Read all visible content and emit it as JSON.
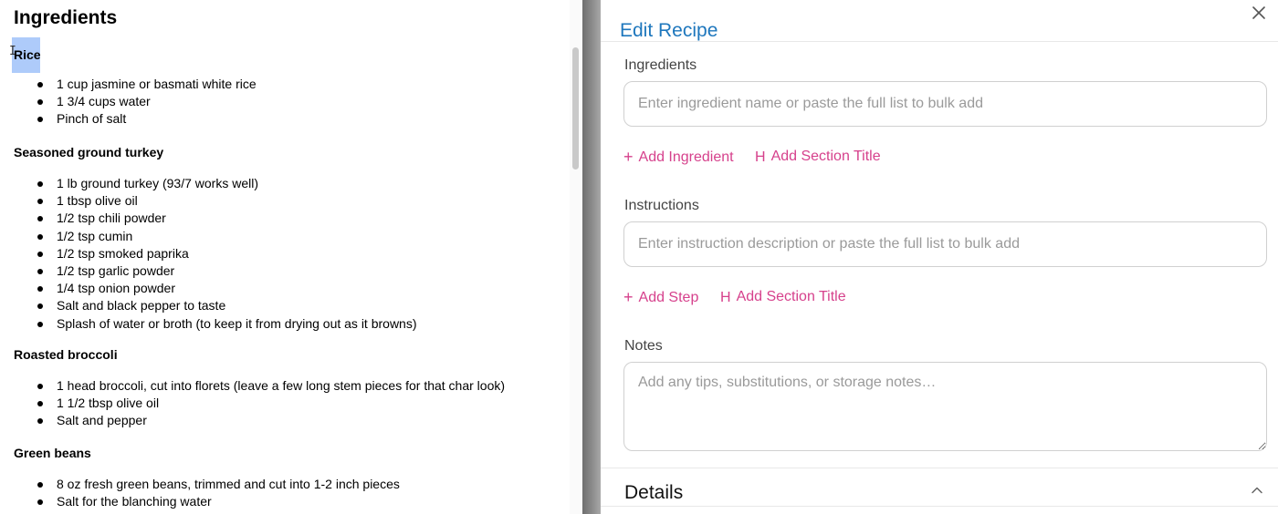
{
  "document": {
    "title": "Ingredients",
    "sections": [
      {
        "title": "Rice",
        "items": [
          "1 cup jasmine or basmati white rice",
          "1 3/4 cups water",
          "Pinch of salt"
        ]
      },
      {
        "title": "Seasoned ground turkey",
        "items": [
          "1 lb ground turkey (93/7 works well)",
          "1 tbsp olive oil",
          "1/2 tsp chili powder",
          "1/2 tsp cumin",
          "1/2 tsp smoked paprika",
          "1/2 tsp garlic powder",
          "1/4 tsp onion powder",
          "Salt and black pepper to taste",
          "Splash of water or broth (to keep it from drying out as it browns)"
        ]
      },
      {
        "title": "Roasted broccoli",
        "items": [
          "1 head broccoli, cut into florets (leave a few long stem pieces for that char look)",
          "1 1/2 tbsp olive oil",
          "Salt and pepper"
        ]
      },
      {
        "title": "Green beans",
        "items": [
          "8 oz fresh green beans, trimmed and cut into 1-2 inch pieces",
          "Salt for the blanching water"
        ]
      }
    ]
  },
  "modal": {
    "title": "Edit Recipe",
    "ingredients": {
      "label": "Ingredients",
      "placeholder": "Enter ingredient name or paste the full list to bulk add",
      "add_label": "Add Ingredient",
      "add_section_label": "Add Section Title"
    },
    "instructions": {
      "label": "Instructions",
      "placeholder": "Enter instruction description or paste the full list to bulk add",
      "add_label": "Add Step",
      "add_section_label": "Add Section Title"
    },
    "notes": {
      "label": "Notes",
      "placeholder": "Add any tips, substitutions, or storage notes…"
    },
    "details": {
      "label": "Details"
    }
  },
  "colors": {
    "title_blue": "#1e77bd",
    "action_pink": "#d6418c",
    "selection": "#aecbfa"
  },
  "icons": [
    "close-icon",
    "plus-icon",
    "heading-icon",
    "chevron-up-icon",
    "text-cursor-icon"
  ]
}
